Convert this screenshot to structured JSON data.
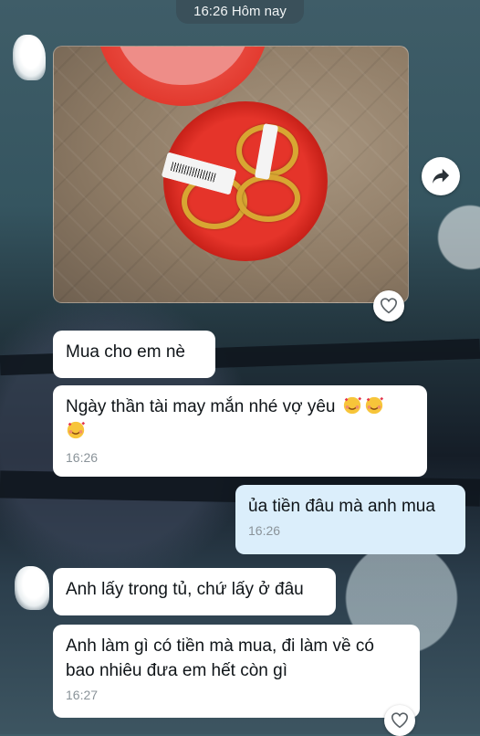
{
  "header": {
    "date_label": "16:26 Hôm nay"
  },
  "messages": [
    {
      "text": "Mua cho em nè"
    },
    {
      "text": "Ngày thần tài may mắn nhé vợ yêu",
      "time": "16:26"
    },
    {
      "text": "ủa tiền đâu mà anh mua",
      "time": "16:26"
    },
    {
      "text": "Anh lấy trong tủ, chứ lấy ở đâu"
    },
    {
      "text_line1": "Anh làm gì có tiền mà mua, đi làm về có",
      "text_line2": "bao nhiêu đưa em hết còn gì",
      "time": "16:27"
    }
  ],
  "icons": {
    "photo_reaction": "heart-outline-icon",
    "share": "share-arrow-icon",
    "message_reaction": "heart-outline-icon",
    "emoji": "smiling-face-with-hearts-emoji"
  },
  "colors": {
    "incoming_bubble": "#ffffff",
    "outgoing_bubble": "#dbeefb",
    "time_text": "#8a9399"
  }
}
